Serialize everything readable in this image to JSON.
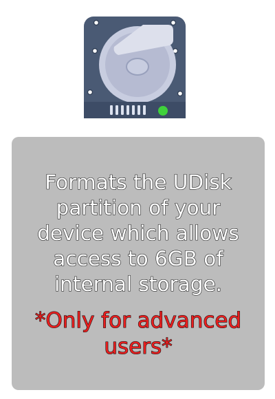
{
  "icon": {
    "name": "hard-drive-icon",
    "led_color": "#3fd13b"
  },
  "card": {
    "description": "Formats the UDisk partition of your device which allows access to 6GB of internal storage.",
    "warning": "*Only for advanced users*",
    "background_color": "#bcbcbc",
    "warning_color": "#ea1f1f"
  }
}
